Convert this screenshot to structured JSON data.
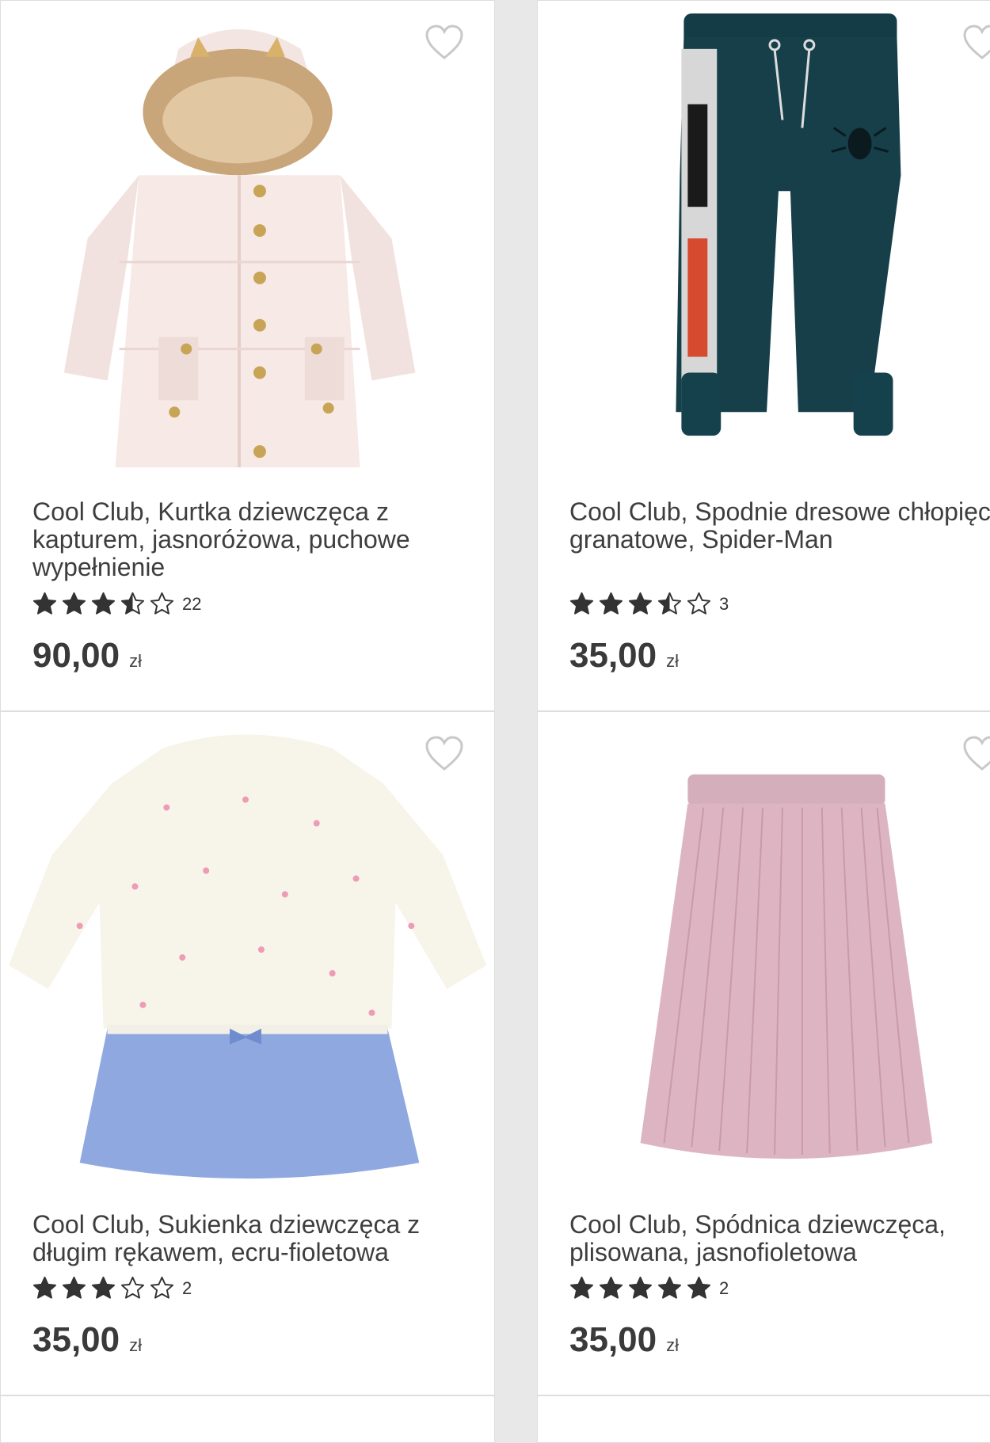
{
  "products": [
    {
      "title": "Cool Club, Kurtka dziewczęca z kapturem, jasnoróżowa, puchowe wypełnienie",
      "rating": 3.5,
      "reviews": "22",
      "price": "90,00",
      "currency": "zł",
      "image": "pink-puffer-jacket-with-fur-hood"
    },
    {
      "title": "Cool Club, Spodnie dresowe chłopięce, granatowe, Spider-Man",
      "rating": 3.5,
      "reviews": "3",
      "price": "35,00",
      "currency": "zł",
      "image": "navy-sweatpants-spider-man"
    },
    {
      "title": "Cool Club, Sukienka dziewczęca z długim rękawem, ecru-fioletowa",
      "rating": 3,
      "reviews": "2",
      "price": "35,00",
      "currency": "zł",
      "image": "ecru-blue-long-sleeve-dress"
    },
    {
      "title": "Cool Club, Spódnica dziewczęca, plisowana, jasnofioletowa",
      "rating": 5,
      "reviews": "2",
      "price": "35,00",
      "currency": "zł",
      "image": "light-purple-pleated-skirt"
    }
  ],
  "icons": {
    "favorite": "heart-outline-icon",
    "star": "star-icon"
  },
  "colors": {
    "star": "#333333",
    "heart": "#c8c8c8",
    "background": "#e8e8e8"
  }
}
